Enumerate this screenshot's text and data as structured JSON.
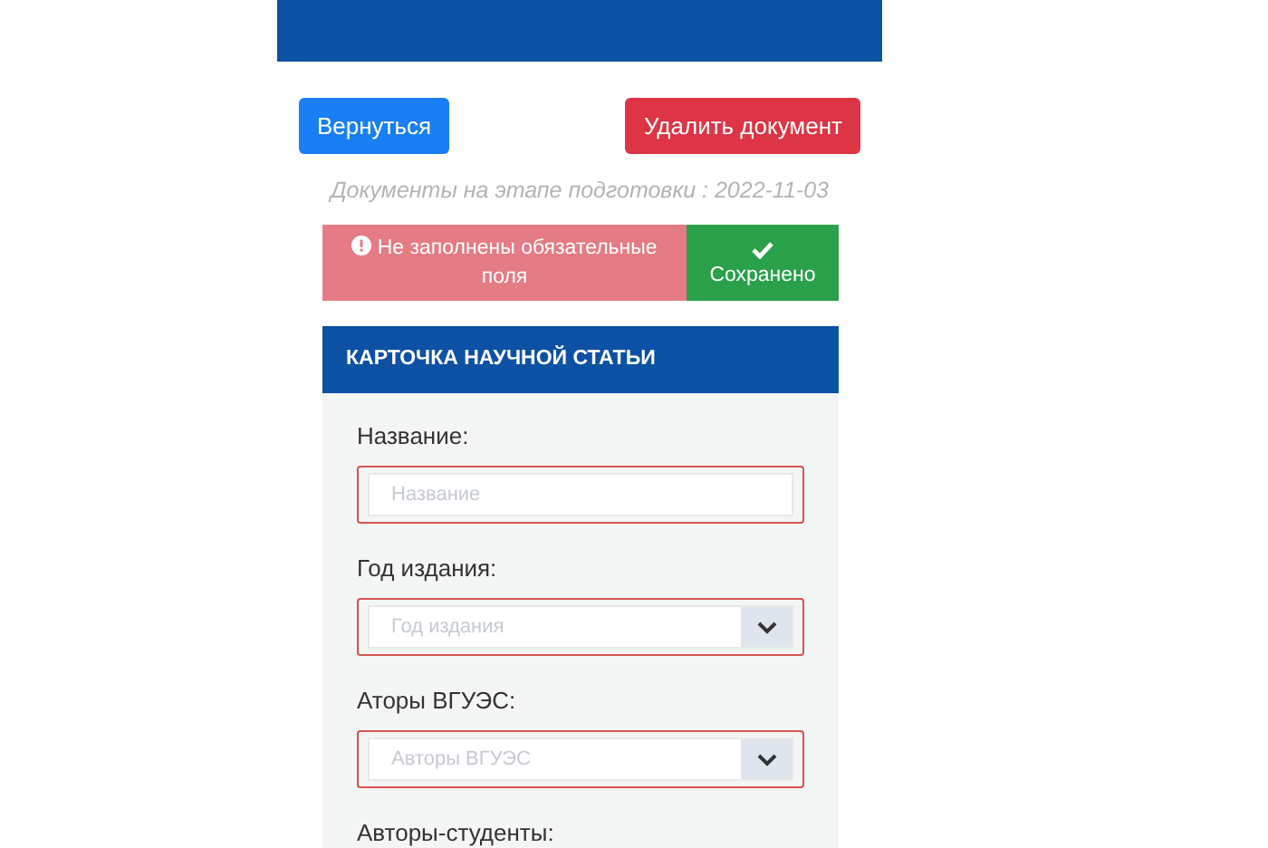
{
  "buttons": {
    "back": "Вернуться",
    "delete": "Удалить документ"
  },
  "subtitle": "Документы на этапе подготовки : 2022-11-03",
  "status": {
    "error": "Не заполнены обязательные поля",
    "saved": "Сохранено"
  },
  "card": {
    "title": "КАРТОЧКА НАУЧНОЙ СТАТЬИ",
    "fields": [
      {
        "kind": "text",
        "label": "Название:",
        "placeholder": "Название",
        "invalid": true
      },
      {
        "kind": "select",
        "label": "Год издания:",
        "placeholder": "Год издания",
        "invalid": true
      },
      {
        "kind": "select",
        "label": "Аторы ВГУЭС:",
        "placeholder": "Авторы ВГУЭС",
        "invalid": true
      },
      {
        "kind": "label",
        "label": "Авторы-студенты:"
      }
    ]
  }
}
